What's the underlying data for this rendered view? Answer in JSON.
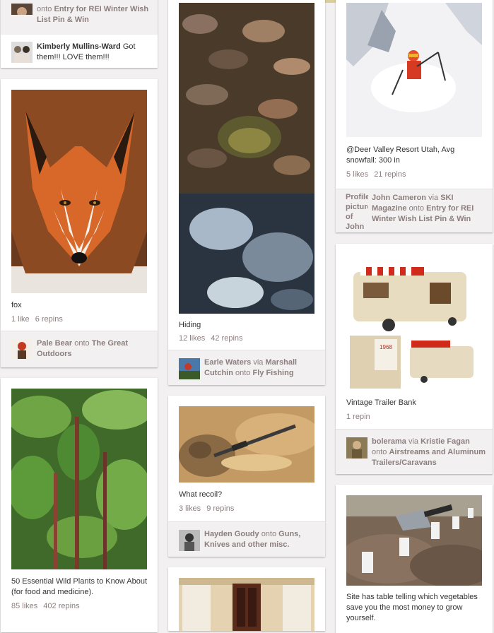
{
  "pins": [
    {
      "id": "rei-top",
      "attribution": {
        "prefix": "",
        "via": "",
        "onto_word": "onto",
        "board": "Entry for REI Winter Wish List Pin & Win"
      },
      "comment": {
        "user": "Kimberly Mullins-Ward",
        "text": "Got them!!! LOVE them!!!"
      }
    },
    {
      "id": "fox",
      "description": "fox",
      "likes": "1 like",
      "repins": "6 repins",
      "attribution": {
        "user": "Pale Bear",
        "onto_word": "onto",
        "board": "The Great Outdoors"
      }
    },
    {
      "id": "hiding",
      "description": "Hiding",
      "likes": "12 likes",
      "repins": "42 repins",
      "attribution": {
        "user": "Earle Waters",
        "via_word": "via",
        "via": "Marshall Cutchin",
        "onto_word": "onto",
        "board": "Fly Fishing"
      }
    },
    {
      "id": "deer-valley",
      "description": "@Deer Valley Resort Utah, Avg snowfall: 300 in",
      "likes": "5 likes",
      "repins": "21 repins",
      "attribution": {
        "avatar_alt": "Profile picture of John Cameron",
        "user": "John Cameron",
        "via_word": "via",
        "via": "SKI Magazine",
        "onto_word": "onto",
        "board": "Entry for REI Winter Wish List Pin & Win"
      }
    },
    {
      "id": "trailer",
      "description": "Vintage Trailer Bank",
      "repins": "1 repin",
      "image_text": "1968",
      "attribution": {
        "user": "bolerama",
        "via_word": "via",
        "via": "Kristie Fagan",
        "onto_word": "onto",
        "board": "Airstreams and Aluminum Trailers/Caravans"
      }
    },
    {
      "id": "plants",
      "description": "50 Essential Wild Plants to Know About (for food and medicine).",
      "likes": "85 likes",
      "repins": "402 repins"
    },
    {
      "id": "recoil",
      "description": "What recoil?",
      "likes": "3 likes",
      "repins": "9 repins",
      "attribution": {
        "user": "Hayden Goudy",
        "onto_word": "onto",
        "board": "Guns, Knives and other misc."
      }
    },
    {
      "id": "money",
      "description": "Site has table telling which vegetables save you the most money to grow yourself."
    }
  ],
  "colors": {
    "background": "#f2f0f0",
    "card": "#ffffff",
    "meta_text": "#8c7e7e",
    "attr_bg": "#f2f0f0"
  }
}
